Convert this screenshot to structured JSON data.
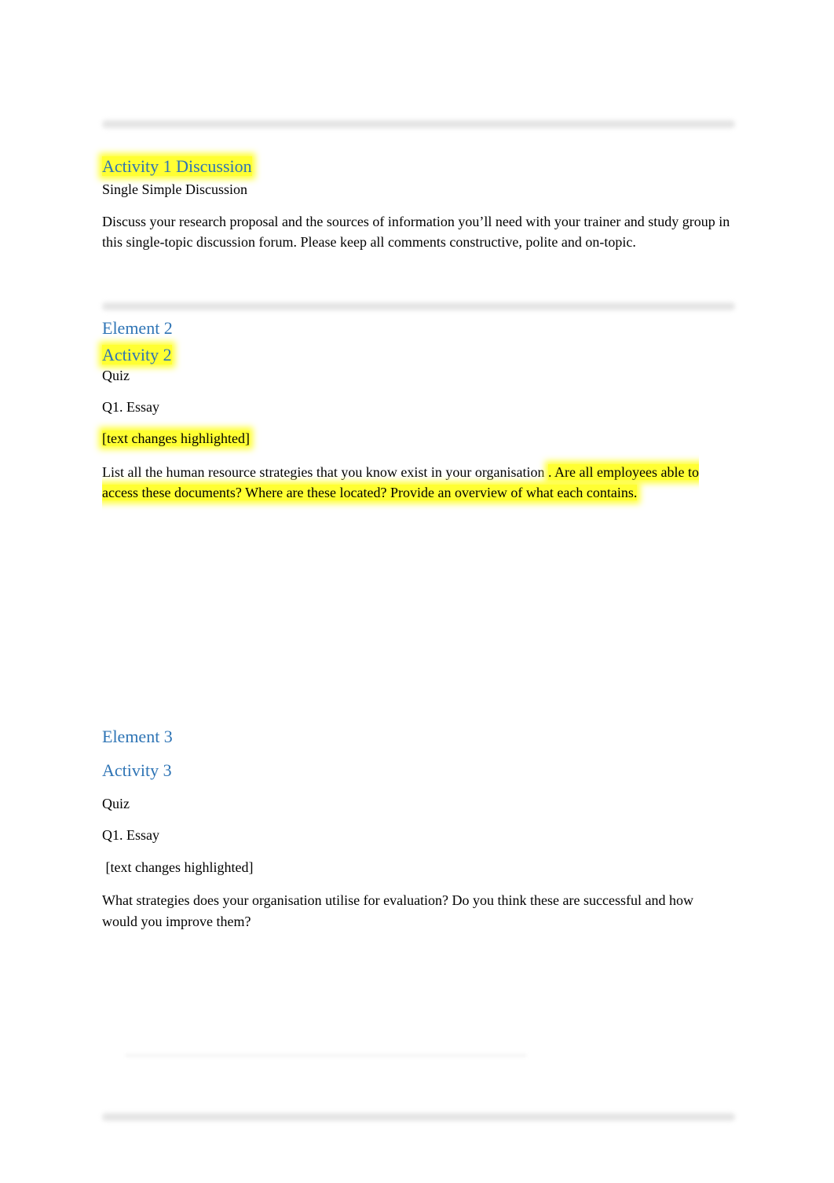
{
  "colors": {
    "heading": "#2E74B5",
    "highlight": "#FFFF33",
    "body_text": "#000000",
    "divider": "#E4E4E4"
  },
  "sections": {
    "activity1": {
      "title": "Activity 1 Discussion",
      "subtitle": "Single Simple Discussion",
      "body": "Discuss your research proposal and the sources of information you’ll need with your trainer and study group in this single-topic discussion forum. Please keep all comments constructive, polite and on-topic."
    },
    "element2": {
      "element_title": "Element 2",
      "activity_title": "Activity 2",
      "type": "Quiz",
      "question_label": "Q1. Essay",
      "note": "[text changes highlighted]",
      "question_plain": "List all the human resource strategies that you know exist in your organisation ",
      "question_highlighted": ". Are all employees able to access these documents? Where are these located? Provide an overview of what each contains."
    },
    "element3": {
      "element_title": "Element 3",
      "activity_title": "Activity 3",
      "type": "Quiz",
      "question_label": "Q1. Essay",
      "note": " [text changes highlighted]",
      "question": "What strategies does your organisation utilise for evaluation? Do you think these are successful and how would you improve them?"
    }
  }
}
